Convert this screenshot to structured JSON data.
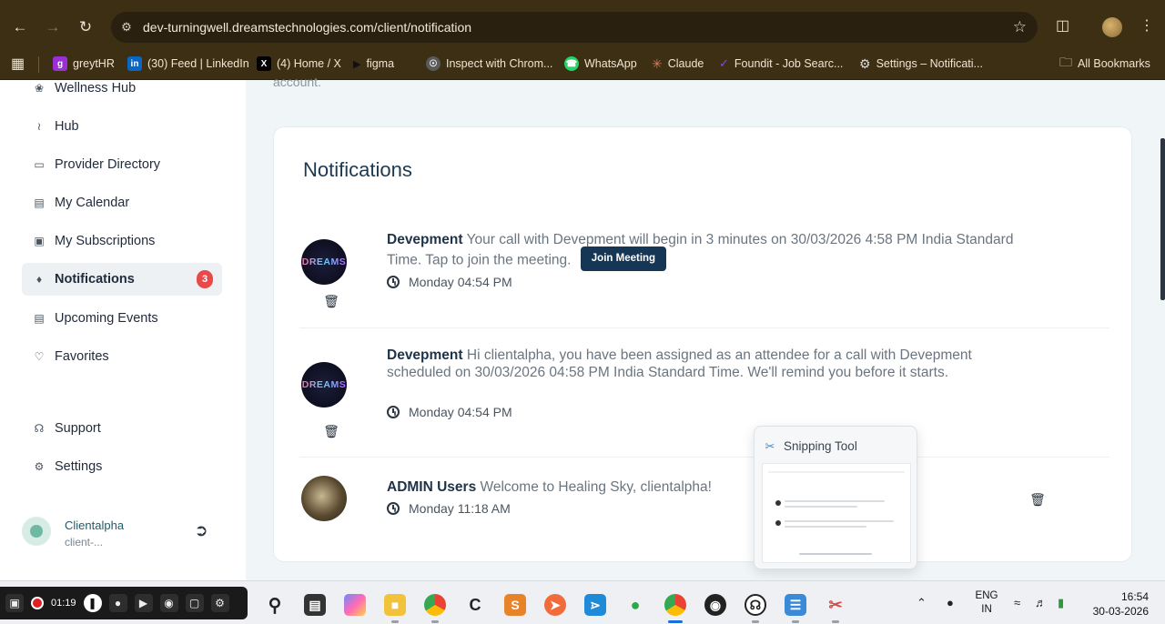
{
  "browser": {
    "url": "dev-turningwell.dreamstechnologies.com/client/notification",
    "bookmarks": [
      {
        "label": "greytHR",
        "icon": "greythr-icon"
      },
      {
        "label": "(30) Feed | LinkedIn",
        "icon": "linkedin-icon"
      },
      {
        "label": "(4) Home / X",
        "icon": "x-icon"
      },
      {
        "label": "figma",
        "icon": "figma-icon"
      },
      {
        "label": "Inspect with Chrom...",
        "icon": "globe-icon"
      },
      {
        "label": "WhatsApp",
        "icon": "whatsapp-icon"
      },
      {
        "label": "Claude",
        "icon": "claude-icon"
      },
      {
        "label": "Foundit - Job Searc...",
        "icon": "foundit-icon"
      },
      {
        "label": "Settings – Notificati...",
        "icon": "gear-icon"
      }
    ],
    "all_bookmarks": "All Bookmarks"
  },
  "sidebar": {
    "items": [
      {
        "label": "Wellness Hub",
        "icon": "leaf-icon"
      },
      {
        "label": "Hub",
        "icon": "share-icon"
      },
      {
        "label": "Provider Directory",
        "icon": "book-icon"
      },
      {
        "label": "My Calendar",
        "icon": "calendar-icon"
      },
      {
        "label": "My Subscriptions",
        "icon": "subscription-icon"
      },
      {
        "label": "Notifications",
        "icon": "bell-icon",
        "badge": "3",
        "active": true
      },
      {
        "label": "Upcoming Events",
        "icon": "calendar-icon"
      },
      {
        "label": "Favorites",
        "icon": "heart-icon"
      },
      {
        "label": "Support",
        "icon": "headset-icon"
      },
      {
        "label": "Settings",
        "icon": "gear-icon"
      }
    ],
    "user": {
      "name": "Clientalpha",
      "role": "client-..."
    }
  },
  "main": {
    "cut_text": "account.",
    "title": "Notifications",
    "notifications": [
      {
        "sender": "Devepment",
        "message": "Your call with Devepment will begin in 3 minutes on 30/03/2026 4:58 PM India Standard Time. Tap to join the meeting.",
        "action": "Join Meeting",
        "time": "Monday 04:54 PM"
      },
      {
        "sender": "Devepment",
        "message": "Hi clientalpha, you have been assigned as an attendee for a call with Devepment scheduled on 30/03/2026 04:58 PM India Standard Time. We'll remind you before it starts.",
        "time": "Monday 04:54 PM"
      },
      {
        "sender": "ADMIN Users",
        "message": "Welcome to Healing Sky, clientalpha!",
        "time": "Monday 11:18 AM"
      }
    ],
    "avatar_logo": "DREAMS"
  },
  "snipping": {
    "title": "Snipping Tool"
  },
  "taskbar": {
    "rec_time": "01:19",
    "lang": "ENG",
    "region": "IN",
    "time": "16:54",
    "date": "30-03-2026"
  }
}
